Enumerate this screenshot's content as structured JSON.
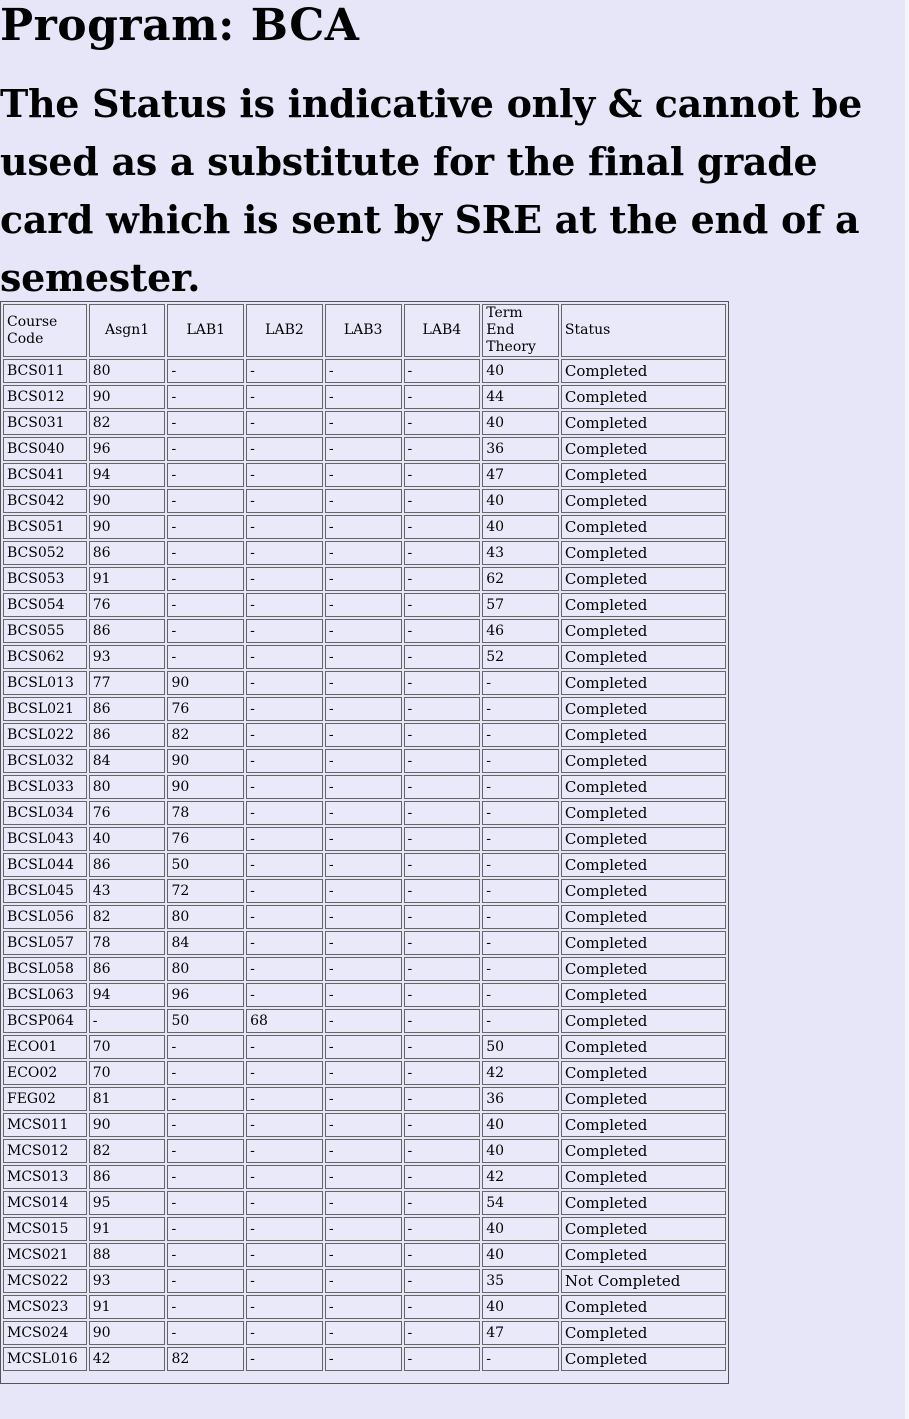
{
  "header": {
    "program": "Program: BCA",
    "notice": "The Status is indicative only & cannot be used as a substitute for the final grade card which is sent by SRE at the end of a semester."
  },
  "table": {
    "columns": [
      "Course Code",
      "Asgn1",
      "LAB1",
      "LAB2",
      "LAB3",
      "LAB4",
      "Term End Theory",
      "Status"
    ],
    "rows": [
      [
        "BCS011",
        "80",
        "-",
        "-",
        "-",
        "-",
        "40",
        "Completed"
      ],
      [
        "BCS012",
        "90",
        "-",
        "-",
        "-",
        "-",
        "44",
        "Completed"
      ],
      [
        "BCS031",
        "82",
        "-",
        "-",
        "-",
        "-",
        "40",
        "Completed"
      ],
      [
        "BCS040",
        "96",
        "-",
        "-",
        "-",
        "-",
        "36",
        "Completed"
      ],
      [
        "BCS041",
        "94",
        "-",
        "-",
        "-",
        "-",
        "47",
        "Completed"
      ],
      [
        "BCS042",
        "90",
        "-",
        "-",
        "-",
        "-",
        "40",
        "Completed"
      ],
      [
        "BCS051",
        "90",
        "-",
        "-",
        "-",
        "-",
        "40",
        "Completed"
      ],
      [
        "BCS052",
        "86",
        "-",
        "-",
        "-",
        "-",
        "43",
        "Completed"
      ],
      [
        "BCS053",
        "91",
        "-",
        "-",
        "-",
        "-",
        "62",
        "Completed"
      ],
      [
        "BCS054",
        "76",
        "-",
        "-",
        "-",
        "-",
        "57",
        "Completed"
      ],
      [
        "BCS055",
        "86",
        "-",
        "-",
        "-",
        "-",
        "46",
        "Completed"
      ],
      [
        "BCS062",
        "93",
        "-",
        "-",
        "-",
        "-",
        "52",
        "Completed"
      ],
      [
        "BCSL013",
        "77",
        "90",
        "-",
        "-",
        "-",
        "-",
        "Completed"
      ],
      [
        "BCSL021",
        "86",
        "76",
        "-",
        "-",
        "-",
        "-",
        "Completed"
      ],
      [
        "BCSL022",
        "86",
        "82",
        "-",
        "-",
        "-",
        "-",
        "Completed"
      ],
      [
        "BCSL032",
        "84",
        "90",
        "-",
        "-",
        "-",
        "-",
        "Completed"
      ],
      [
        "BCSL033",
        "80",
        "90",
        "-",
        "-",
        "-",
        "-",
        "Completed"
      ],
      [
        "BCSL034",
        "76",
        "78",
        "-",
        "-",
        "-",
        "-",
        "Completed"
      ],
      [
        "BCSL043",
        "40",
        "76",
        "-",
        "-",
        "-",
        "-",
        "Completed"
      ],
      [
        "BCSL044",
        "86",
        "50",
        "-",
        "-",
        "-",
        "-",
        "Completed"
      ],
      [
        "BCSL045",
        "43",
        "72",
        "-",
        "-",
        "-",
        "-",
        "Completed"
      ],
      [
        "BCSL056",
        "82",
        "80",
        "-",
        "-",
        "-",
        "-",
        "Completed"
      ],
      [
        "BCSL057",
        "78",
        "84",
        "-",
        "-",
        "-",
        "-",
        "Completed"
      ],
      [
        "BCSL058",
        "86",
        "80",
        "-",
        "-",
        "-",
        "-",
        "Completed"
      ],
      [
        "BCSL063",
        "94",
        "96",
        "-",
        "-",
        "-",
        "-",
        "Completed"
      ],
      [
        "BCSP064",
        "-",
        "50",
        "68",
        "-",
        "-",
        "-",
        "Completed"
      ],
      [
        "ECO01",
        "70",
        "-",
        "-",
        "-",
        "-",
        "50",
        "Completed"
      ],
      [
        "ECO02",
        "70",
        "-",
        "-",
        "-",
        "-",
        "42",
        "Completed"
      ],
      [
        "FEG02",
        "81",
        "-",
        "-",
        "-",
        "-",
        "36",
        "Completed"
      ],
      [
        "MCS011",
        "90",
        "-",
        "-",
        "-",
        "-",
        "40",
        "Completed"
      ],
      [
        "MCS012",
        "82",
        "-",
        "-",
        "-",
        "-",
        "40",
        "Completed"
      ],
      [
        "MCS013",
        "86",
        "-",
        "-",
        "-",
        "-",
        "42",
        "Completed"
      ],
      [
        "MCS014",
        "95",
        "-",
        "-",
        "-",
        "-",
        "54",
        "Completed"
      ],
      [
        "MCS015",
        "91",
        "-",
        "-",
        "-",
        "-",
        "40",
        "Completed"
      ],
      [
        "MCS021",
        "88",
        "-",
        "-",
        "-",
        "-",
        "40",
        "Completed"
      ],
      [
        "MCS022",
        "93",
        "-",
        "-",
        "-",
        "-",
        "35",
        "Not Completed"
      ],
      [
        "MCS023",
        "91",
        "-",
        "-",
        "-",
        "-",
        "40",
        "Completed"
      ],
      [
        "MCS024",
        "90",
        "-",
        "-",
        "-",
        "-",
        "47",
        "Completed"
      ],
      [
        "MCSL016",
        "42",
        "82",
        "-",
        "-",
        "-",
        "-",
        "Completed"
      ]
    ]
  }
}
